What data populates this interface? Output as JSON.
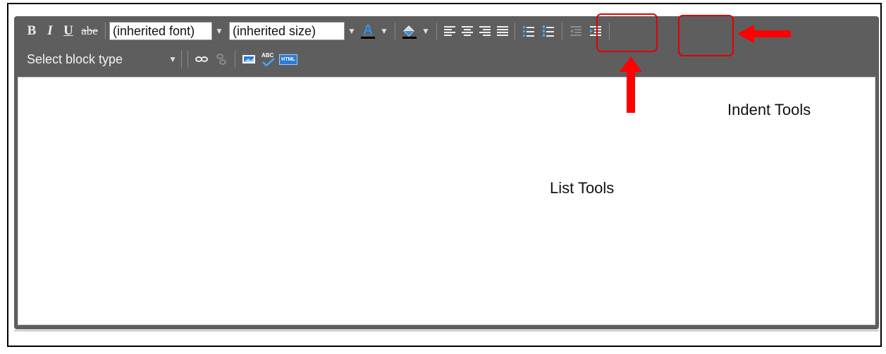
{
  "toolbar": {
    "bold_label": "B",
    "italic_label": "I",
    "underline_label": "U",
    "strike_label": "abe",
    "font_select_value": "(inherited font)",
    "size_select_value": "(inherited size)",
    "text_color_label": "A",
    "block_type_value": "Select block type",
    "spellcheck_label": "ABC",
    "html_label": "HTML"
  },
  "annotations": {
    "indent_label": "Indent Tools",
    "list_label": "List Tools",
    "highlight_color": "#e00000"
  },
  "colors": {
    "toolbar_bg": "#5e5e5e",
    "arrow": "#ff0000"
  }
}
